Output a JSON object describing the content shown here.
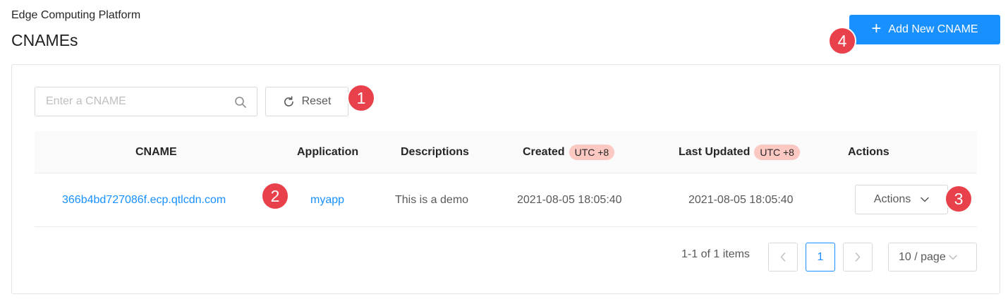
{
  "header": {
    "breadcrumb": "Edge Computing Platform",
    "title": "CNAMEs",
    "add_button_label": "Add New CNAME"
  },
  "toolbar": {
    "search_placeholder": "Enter a CNAME",
    "reset_label": "Reset"
  },
  "table": {
    "columns": [
      "CNAME",
      "Application",
      "Descriptions",
      "Created",
      "Last Updated",
      "Actions"
    ],
    "timezone_badge": "UTC +8",
    "rows": [
      {
        "cname": "366b4bd727086f.ecp.qtlcdn.com",
        "application": "myapp",
        "description": "This is a demo",
        "created": "2021-08-05 18:05:40",
        "last_updated": "2021-08-05 18:05:40",
        "actions_label": "Actions"
      }
    ]
  },
  "pagination": {
    "total_text": "1-1 of 1 items",
    "current_page": "1",
    "page_size": "10 / page"
  },
  "markers": [
    "1",
    "2",
    "3",
    "4"
  ],
  "colors": {
    "primary": "#1890ff",
    "marker": "#e8414b",
    "badge": "#fbc8c2"
  }
}
